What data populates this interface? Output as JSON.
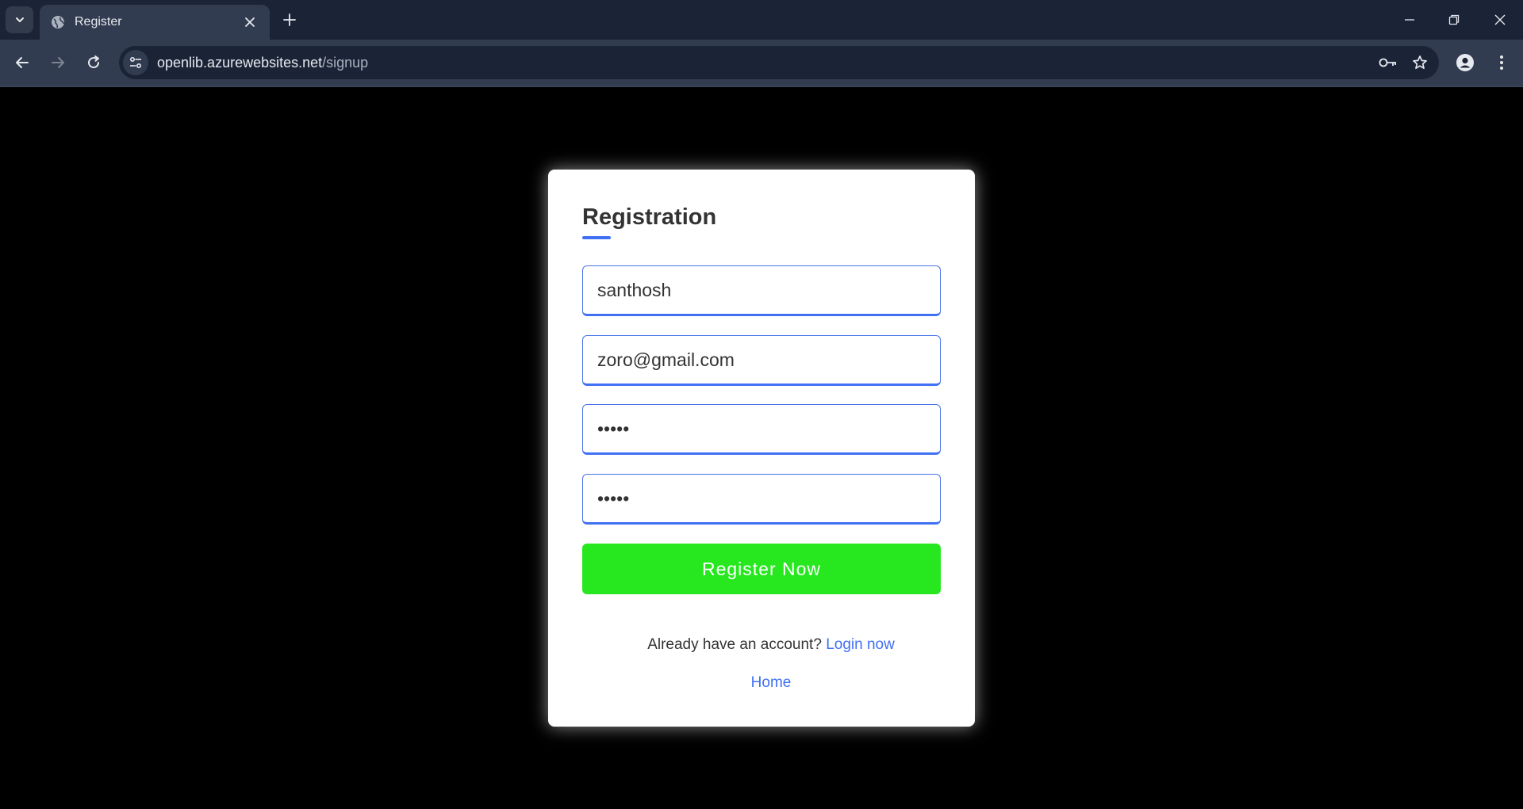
{
  "browser": {
    "tab_title": "Register",
    "url_host": "openlib.azurewebsites.net",
    "url_path": "/signup"
  },
  "form": {
    "title": "Registration",
    "name_value": "santhosh",
    "email_value": "zoro@gmail.com",
    "password_value": "hello",
    "confirm_password_value": "hello",
    "register_label": "Register Now",
    "login_prompt": "Already have an account?",
    "login_link": "Login now",
    "home_link": "Home"
  },
  "colors": {
    "accent": "#4070f4",
    "button": "#27e71f",
    "page_bg": "#000000",
    "chrome_bg": "#1b2436",
    "toolbar_bg": "#323c50"
  },
  "icons": {
    "tab_search": "chevron-down-icon",
    "favicon": "globe-icon",
    "close": "close-icon",
    "new_tab": "plus-icon",
    "back": "arrow-left-icon",
    "forward": "arrow-right-icon",
    "reload": "reload-icon",
    "site_info": "tune-icon",
    "password_key": "key-icon",
    "bookmark": "star-icon",
    "profile": "person-icon",
    "menu": "kebab-menu-icon"
  }
}
